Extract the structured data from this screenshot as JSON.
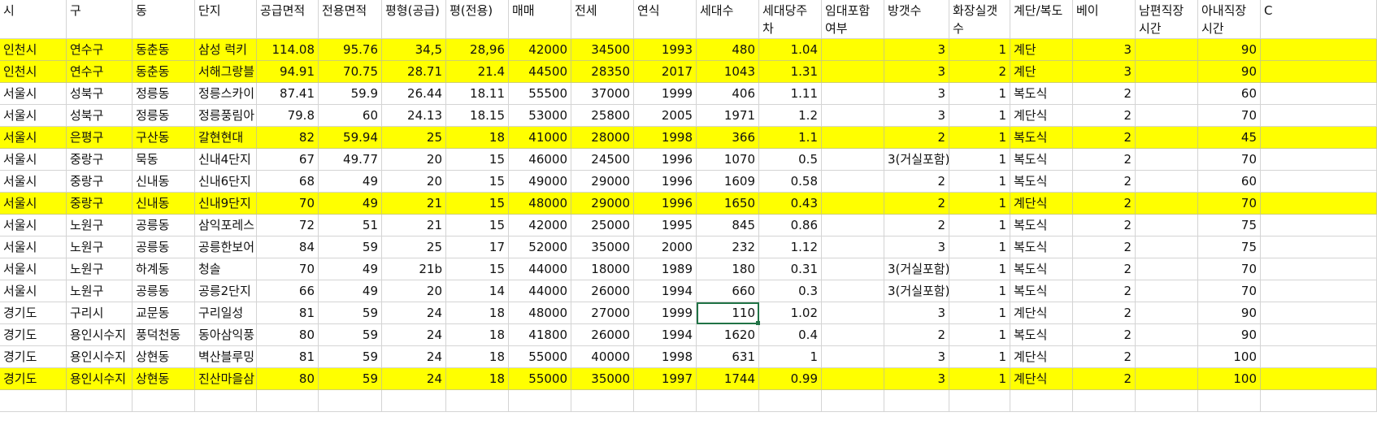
{
  "columns": [
    {
      "label": "시",
      "align": "txt"
    },
    {
      "label": "구",
      "align": "txt"
    },
    {
      "label": "동",
      "align": "txt"
    },
    {
      "label": "단지",
      "align": "txt"
    },
    {
      "label": "공급면적",
      "align": "num"
    },
    {
      "label": "전용면적",
      "align": "num"
    },
    {
      "label": "평형(공급)",
      "align": "num"
    },
    {
      "label": "평(전용)",
      "align": "num"
    },
    {
      "label": "매매",
      "align": "num"
    },
    {
      "label": "전세",
      "align": "num"
    },
    {
      "label": "연식",
      "align": "num"
    },
    {
      "label": "세대수",
      "align": "num"
    },
    {
      "label": "세대당주차",
      "align": "num"
    },
    {
      "label": "임대포함여부",
      "align": "num"
    },
    {
      "label": "방갯수",
      "align": "num"
    },
    {
      "label": "화장실갯수",
      "align": "num"
    },
    {
      "label": "계단/복도",
      "align": "txt"
    },
    {
      "label": "베이",
      "align": "num"
    },
    {
      "label": "남편직장시간",
      "align": "num"
    },
    {
      "label": "아내직장시간",
      "align": "num"
    },
    {
      "label": "C",
      "align": "txt"
    }
  ],
  "rows": [
    {
      "highlight": true,
      "cells": [
        "인천시",
        "연수구",
        "동춘동",
        "삼성 럭키",
        "114.08",
        "95.76",
        "34,5",
        "28,96",
        "42000",
        "34500",
        "1993",
        "480",
        "1.04",
        "",
        "3",
        "1",
        "계단",
        "3",
        "",
        "90",
        ""
      ]
    },
    {
      "highlight": true,
      "cells": [
        "인천시",
        "연수구",
        "동춘동",
        "서해그랑블",
        "94.91",
        "70.75",
        "28.71",
        "21.4",
        "44500",
        "28350",
        "2017",
        "1043",
        "1.31",
        "",
        "3",
        "2",
        "계단",
        "3",
        "",
        "90",
        ""
      ]
    },
    {
      "highlight": false,
      "cells": [
        "서울시",
        "성북구",
        "정릉동",
        "정릉스카이",
        "87.41",
        "59.9",
        "26.44",
        "18.11",
        "55500",
        "37000",
        "1999",
        "406",
        "1.11",
        "",
        "3",
        "1",
        "복도식",
        "2",
        "",
        "60",
        ""
      ]
    },
    {
      "highlight": false,
      "cells": [
        "서울시",
        "성북구",
        "정릉동",
        "정릉풍림아",
        "79.8",
        "60",
        "24.13",
        "18.15",
        "53000",
        "25800",
        "2005",
        "1971",
        "1.2",
        "",
        "3",
        "1",
        "계단식",
        "2",
        "",
        "70",
        ""
      ]
    },
    {
      "highlight": true,
      "cells": [
        "서울시",
        "은평구",
        "구산동",
        "갈현현대",
        "82",
        "59.94",
        "25",
        "18",
        "41000",
        "28000",
        "1998",
        "366",
        "1.1",
        "",
        "2",
        "1",
        "복도식",
        "2",
        "",
        "45",
        ""
      ]
    },
    {
      "highlight": false,
      "cells": [
        "서울시",
        "중랑구",
        "묵동",
        "신내4단지",
        "67",
        "49.77",
        "20",
        "15",
        "46000",
        "24500",
        "1996",
        "1070",
        "0.5",
        "",
        "3(거실포함)",
        "1",
        "복도식",
        "2",
        "",
        "70",
        ""
      ]
    },
    {
      "highlight": false,
      "cells": [
        "서울시",
        "중랑구",
        "신내동",
        "신내6단지",
        "68",
        "49",
        "20",
        "15",
        "49000",
        "29000",
        "1996",
        "1609",
        "0.58",
        "",
        "2",
        "1",
        "복도식",
        "2",
        "",
        "60",
        ""
      ]
    },
    {
      "highlight": true,
      "cells": [
        "서울시",
        "중랑구",
        "신내동",
        "신내9단지",
        "70",
        "49",
        "21",
        "15",
        "48000",
        "29000",
        "1996",
        "1650",
        "0.43",
        "",
        "2",
        "1",
        "계단식",
        "2",
        "",
        "70",
        ""
      ]
    },
    {
      "highlight": false,
      "cells": [
        "서울시",
        "노원구",
        "공릉동",
        "삼익포레스",
        "72",
        "51",
        "21",
        "15",
        "42000",
        "25000",
        "1995",
        "845",
        "0.86",
        "",
        "2",
        "1",
        "복도식",
        "2",
        "",
        "75",
        ""
      ]
    },
    {
      "highlight": false,
      "cells": [
        "서울시",
        "노원구",
        "공릉동",
        "공릉한보어",
        "84",
        "59",
        "25",
        "17",
        "52000",
        "35000",
        "2000",
        "232",
        "1.12",
        "",
        "3",
        "1",
        "복도식",
        "2",
        "",
        "75",
        ""
      ]
    },
    {
      "highlight": false,
      "cells": [
        "서울시",
        "노원구",
        "하계동",
        "청솔",
        "70",
        "49",
        "21b",
        "15",
        "44000",
        "18000",
        "1989",
        "180",
        "0.31",
        "",
        "3(거실포함)",
        "1",
        "복도식",
        "2",
        "",
        "70",
        ""
      ]
    },
    {
      "highlight": false,
      "cells": [
        "서울시",
        "노원구",
        "공릉동",
        "공릉2단지",
        "66",
        "49",
        "20",
        "14",
        "44000",
        "26000",
        "1994",
        "660",
        "0.3",
        "",
        "3(거실포함)",
        "1",
        "복도식",
        "2",
        "",
        "70",
        ""
      ]
    },
    {
      "highlight": false,
      "cells": [
        "경기도",
        "구리시",
        "교문동",
        "구리일성",
        "81",
        "59",
        "24",
        "18",
        "48000",
        "27000",
        "1999",
        "110",
        "1.02",
        "",
        "3",
        "1",
        "계단식",
        "2",
        "",
        "90",
        ""
      ]
    },
    {
      "highlight": false,
      "cells": [
        "경기도",
        "용인시수지",
        "풍덕천동",
        "동아삼익풍",
        "80",
        "59",
        "24",
        "18",
        "41800",
        "26000",
        "1994",
        "1620",
        "0.4",
        "",
        "2",
        "1",
        "복도식",
        "2",
        "",
        "90",
        ""
      ]
    },
    {
      "highlight": false,
      "cells": [
        "경기도",
        "용인시수지",
        "상현동",
        "벽산블루밍",
        "81",
        "59",
        "24",
        "18",
        "55000",
        "40000",
        "1998",
        "631",
        "1",
        "",
        "3",
        "1",
        "계단식",
        "2",
        "",
        "100",
        ""
      ]
    },
    {
      "highlight": true,
      "cells": [
        "경기도",
        "용인시수지",
        "상현동",
        "진산마을삼",
        "80",
        "59",
        "24",
        "18",
        "55000",
        "35000",
        "1997",
        "1744",
        "0.99",
        "",
        "3",
        "1",
        "계단식",
        "2",
        "",
        "100",
        ""
      ]
    }
  ],
  "selected": {
    "row": 12,
    "col": 11
  },
  "colors": {
    "highlight": "#ffff00",
    "selection": "#217346",
    "gridline": "#d4d4d4"
  }
}
